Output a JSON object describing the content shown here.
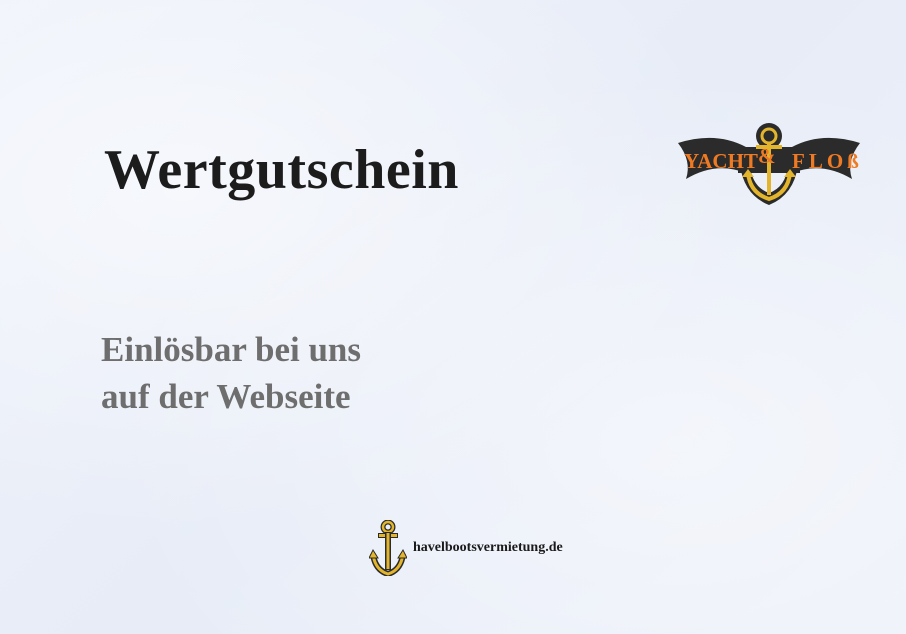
{
  "voucher": {
    "title": "Wertgutschein",
    "subtitle_line1": "Einlösbar bei uns",
    "subtitle_line2": "auf der Webseite"
  },
  "logo": {
    "left_text": "YACHT",
    "ampersand": "&",
    "right_text": "FLOß",
    "icon": "anchor-icon"
  },
  "footer": {
    "icon": "anchor-icon",
    "url": "havelbootsvermietung.de"
  },
  "colors": {
    "background": "#e9eef8",
    "title": "#1c1c1c",
    "subtitle": "#6e6e6e",
    "anchor_gold": "#e2b52c",
    "logo_orange": "#ef7a24",
    "logo_dark": "#2b2b2b"
  }
}
